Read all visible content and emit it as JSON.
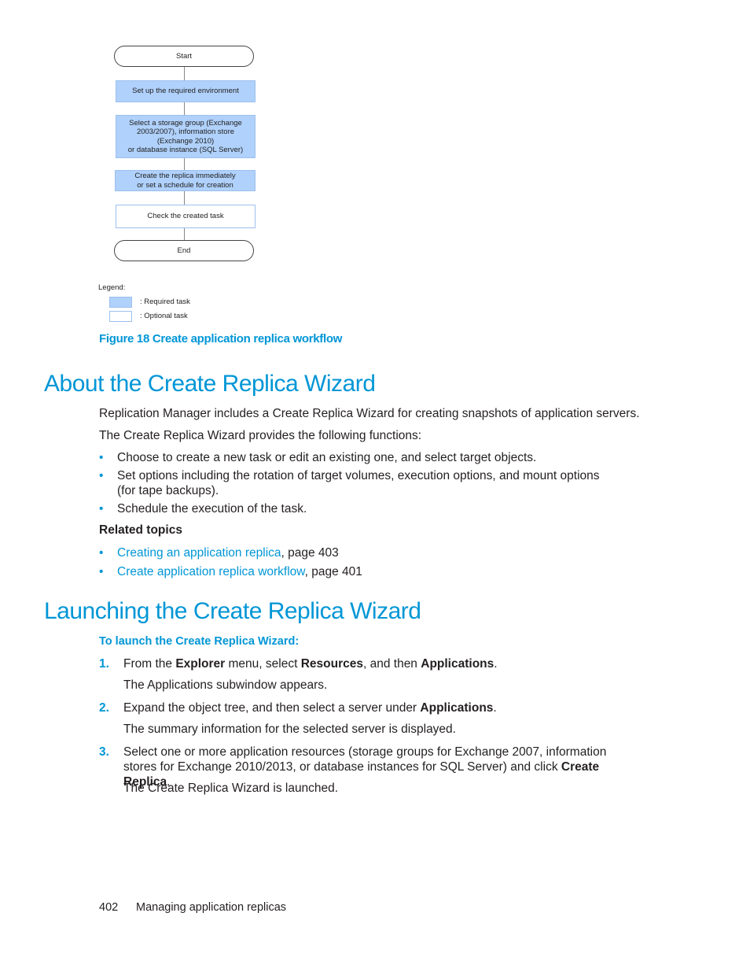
{
  "flowchart": {
    "start": "Start",
    "steps": [
      {
        "text": "Set up the required environment",
        "type": "required"
      },
      {
        "text": "Select a storage group (Exchange\n2003/2007), information store\n(Exchange 2010)\nor database instance (SQL Server)",
        "type": "required"
      },
      {
        "text": "Create the replica immediately\nor set a schedule for creation",
        "type": "required"
      },
      {
        "text": "Check the created task",
        "type": "optional"
      }
    ],
    "end": "End",
    "legend": {
      "title": "Legend:",
      "required": ": Required task",
      "optional": ": Optional task",
      "required_color": "#b0d1fb",
      "optional_color": "#ffffff"
    }
  },
  "figure_caption": "Figure 18 Create application replica workflow",
  "section1": {
    "title": "About the Create Replica Wizard",
    "para1": "Replication Manager includes a Create Replica Wizard for creating snapshots of application servers.",
    "para2": "The Create Replica Wizard provides the following functions:",
    "bullets": [
      "Choose to create a new task or edit an existing one, and select target objects.",
      "Set options including the rotation of target volumes, execution options, and mount options (for tape backups).",
      "Schedule the execution of the task."
    ],
    "related_title": "Related topics",
    "related": [
      {
        "link": "Creating an application replica",
        "suffix": ", page 403"
      },
      {
        "link": "Create application replica workflow",
        "suffix": ", page 401"
      }
    ]
  },
  "section2": {
    "title": "Launching the Create Replica Wizard",
    "procedure_title": "To launch the Create Replica Wizard:",
    "steps": [
      {
        "num": "1.",
        "parts": [
          "From the ",
          "Explorer",
          " menu, select ",
          "Resources",
          ", and then ",
          "Applications",
          "."
        ],
        "note": "The Applications subwindow appears."
      },
      {
        "num": "2.",
        "parts": [
          "Expand the object tree, and then select a server under ",
          "Applications",
          "."
        ],
        "note": "The summary information for the selected server is displayed."
      },
      {
        "num": "3.",
        "parts": [
          "Select one or more application resources (storage groups for Exchange 2007, information stores for Exchange 2010/2013, or database instances for SQL Server) and click ",
          "Create Replica",
          "."
        ],
        "note": "The Create Replica Wizard is launched."
      }
    ]
  },
  "footer": {
    "page_number": "402",
    "chapter": "Managing application replicas"
  },
  "colors": {
    "accent": "#0096d6",
    "text": "#231f20"
  }
}
